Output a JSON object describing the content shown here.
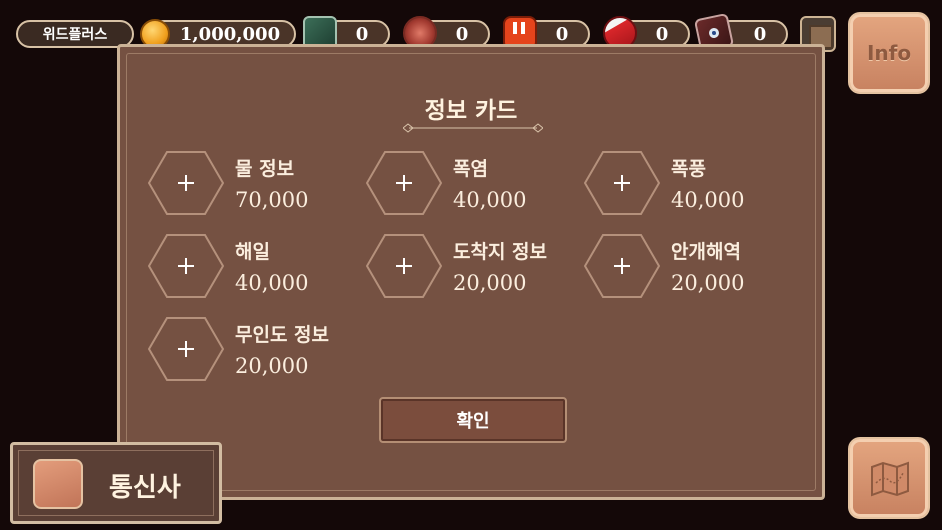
{
  "header": {
    "player_name": "위드플러스",
    "gold": "1,000,000",
    "resources": [
      {
        "icon": "jade-bag-icon",
        "count": "0"
      },
      {
        "icon": "meat-icon",
        "count": "0"
      },
      {
        "icon": "red-backpack-icon",
        "count": "0"
      },
      {
        "icon": "red-sneaker-icon",
        "count": "0"
      },
      {
        "icon": "treasure-book-icon",
        "count": "0"
      }
    ],
    "extra_icon": "crate-icon"
  },
  "info_button": {
    "label": "Info"
  },
  "panel": {
    "title": "정보 카드",
    "cards": [
      {
        "name": "물 정보",
        "price": "70,000"
      },
      {
        "name": "폭염",
        "price": "40,000"
      },
      {
        "name": "폭풍",
        "price": "40,000"
      },
      {
        "name": "해일",
        "price": "40,000"
      },
      {
        "name": "도착지 정보",
        "price": "20,000"
      },
      {
        "name": "안개해역",
        "price": "20,000"
      },
      {
        "name": "무인도 정보",
        "price": "20,000"
      }
    ],
    "confirm_label": "확인"
  },
  "comm_button": {
    "label": "통신사"
  },
  "map_button": {
    "icon": "map-icon"
  },
  "colors": {
    "panel": "#755142",
    "border": "#cbb296",
    "accent": "#e4a680",
    "background": "#140808"
  }
}
